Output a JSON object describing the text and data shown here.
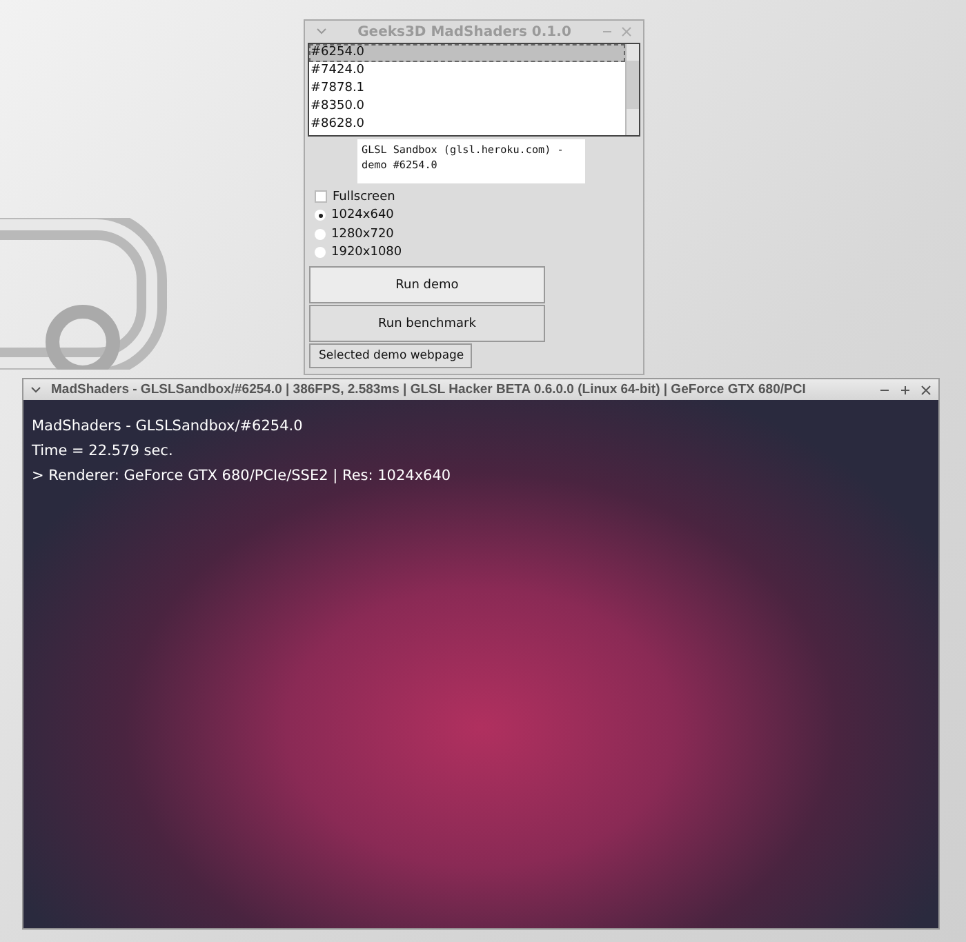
{
  "launcher": {
    "title": "Geeks3D MadShaders 0.1.0",
    "demos": [
      {
        "label": "#6254.0",
        "selected": true
      },
      {
        "label": "#7424.0",
        "selected": false
      },
      {
        "label": "#7878.1",
        "selected": false
      },
      {
        "label": "#8350.0",
        "selected": false
      },
      {
        "label": "#8628.0",
        "selected": false
      }
    ],
    "description": "GLSL Sandbox (glsl.heroku.com) - demo #6254.0",
    "fullscreen": {
      "label": "Fullscreen",
      "checked": false
    },
    "resolutions": [
      {
        "label": "1024x640",
        "selected": true
      },
      {
        "label": "1280x720",
        "selected": false
      },
      {
        "label": "1920x1080",
        "selected": false
      }
    ],
    "buttons": [
      "Run demo",
      "Run benchmark",
      "Selected demo webpage"
    ]
  },
  "render_window": {
    "title": "MadShaders - GLSLSandbox/#6254.0 | 386FPS, 2.583ms | GLSL Hacker BETA 0.6.0.0 (Linux 64-bit) | GeForce GTX 680/PCI",
    "overlay_lines": [
      "MadShaders - GLSLSandbox/#6254.0",
      "Time = 22.579 sec.",
      "> Renderer: GeForce GTX 680/PCIe/SSE2 | Res: 1024x640"
    ]
  }
}
